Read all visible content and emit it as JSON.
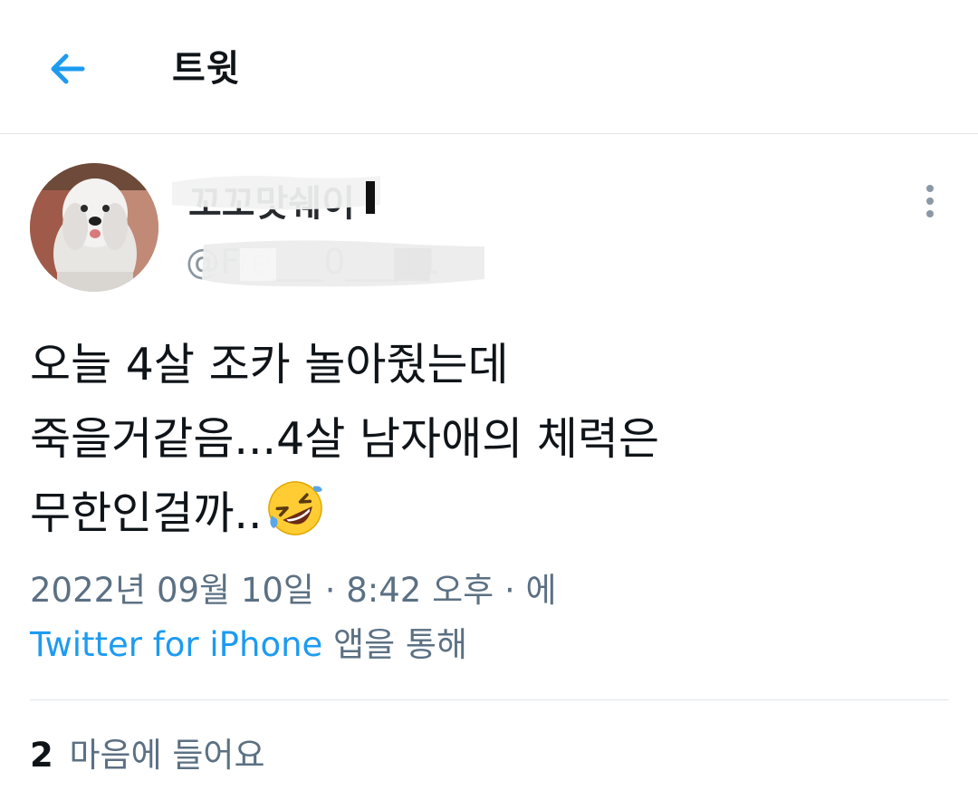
{
  "header": {
    "title": "트윗",
    "back_icon": "arrow-left-icon",
    "accent": "#1d9bf0"
  },
  "tweet": {
    "author": {
      "display_name": "꼬꼬맛쉐이",
      "handle": "@Fre___0___11"
    },
    "text_lines": [
      "오늘 4살 조카 놀아줬는데",
      "죽을거같음...4살 남자애의 체력은",
      "무한인걸까.."
    ],
    "emoji": "rolling-on-the-floor-laughing-emoji",
    "timestamp": "2022년 09월 10일 · 8:42 오후 · 에",
    "source": {
      "link": "Twitter for iPhone",
      "suffix": "앱을 통해"
    },
    "likes": {
      "count": "2",
      "label": "마음에 들어요"
    }
  }
}
